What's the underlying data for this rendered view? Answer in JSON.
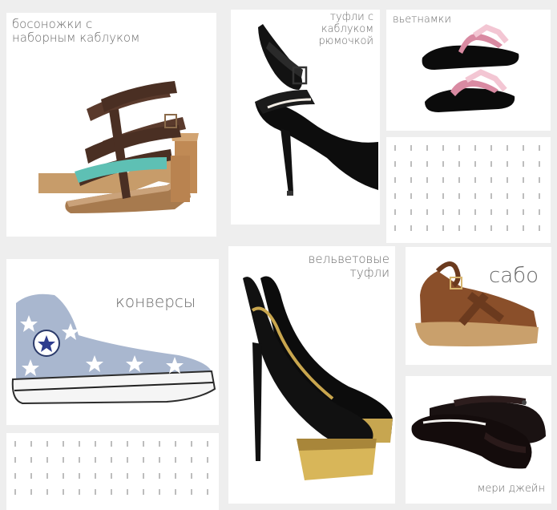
{
  "gallery": {
    "items": [
      {
        "id": "sandals",
        "label_lines": [
          "босоножки с",
          "наборным каблуком"
        ]
      },
      {
        "id": "heels",
        "label_lines": [
          "туфли с",
          "каблуком",
          "рюмочкой"
        ]
      },
      {
        "id": "flipflops",
        "label_lines": [
          "вьетнамки"
        ]
      },
      {
        "id": "converse",
        "label_lines": [
          "конверсы"
        ]
      },
      {
        "id": "velvet",
        "label_lines": [
          "вельветовые",
          "туфли"
        ]
      },
      {
        "id": "clogs",
        "label_lines": [
          "сабо"
        ]
      },
      {
        "id": "maryjane",
        "label_lines": [
          "мери джейн"
        ]
      }
    ]
  },
  "colors": {
    "background": "#eeeeee",
    "card": "#ffffff",
    "label_text": "#6b6b6b",
    "pattern": "#bdbdbd"
  },
  "icons": [
    "sandal-image",
    "heel-shoe-image",
    "flipflop-image",
    "converse-sneaker-image",
    "velvet-platform-pump-image",
    "clog-image",
    "mary-jane-shoe-image"
  ]
}
